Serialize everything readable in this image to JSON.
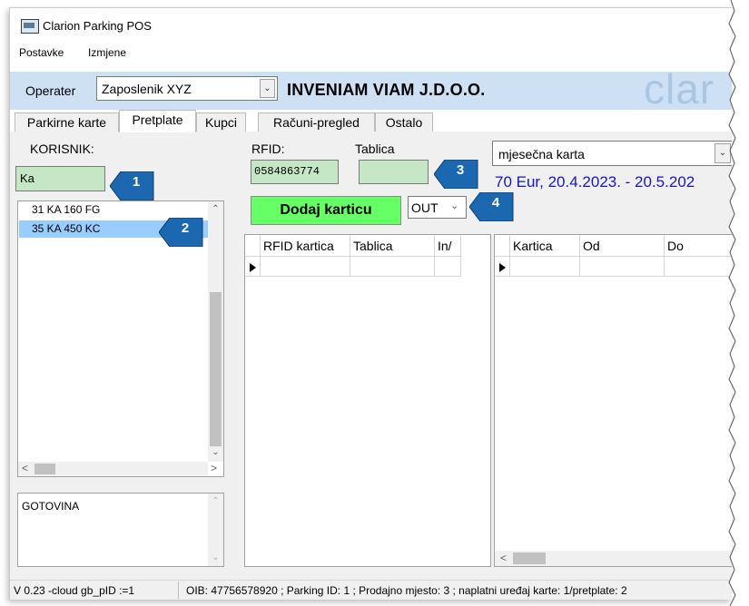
{
  "window": {
    "title": "Clarion Parking POS"
  },
  "menu": [
    "Postavke",
    "Izmjene"
  ],
  "operator": {
    "label": "Operater",
    "selected": "Zaposlenik XYZ",
    "company": "INVENIAM VIAM J.D.O.O.",
    "logo_text": "clar"
  },
  "tabs": [
    "Parkirne karte",
    "Pretplate",
    "Kupci",
    "Računi-pregled",
    "Ostalo"
  ],
  "active_tab": "Pretplate",
  "korisnik": {
    "label": "KORISNIK:",
    "search_value": "Ka",
    "items": [
      "31  KA 160 FG",
      "35  KA 450 KC"
    ],
    "selected_index": 1,
    "payment_text": "GOTOVINA"
  },
  "card": {
    "rfid_label": "RFID:",
    "rfid_value": "0584863774",
    "tablica_label": "Tablica",
    "tablica_value": "",
    "add_button": "Dodaj karticu",
    "direction": "OUT",
    "type_selected": "mjesečna karta",
    "price_info": "70 Eur,  20.4.2023. - 20.5.202"
  },
  "grid_cards": {
    "columns": [
      "RFID kartica",
      "Tablica",
      "In/"
    ]
  },
  "grid_subs": {
    "columns": [
      "Kartica",
      "Od",
      "Do"
    ]
  },
  "status": {
    "version": "V 0.23 -cloud gb_pID :=1",
    "info": "OIB: 47756578920 ; Parking ID: 1 ; Prodajno mjesto: 3 ; naplatni uređaj karte: 1/pretplate: 2"
  },
  "callouts": [
    "1",
    "2",
    "3",
    "4"
  ],
  "colors": {
    "accent_bar": "#cde0f4",
    "field_green": "#c6e7c6",
    "button_green": "#66ff66",
    "selection": "#99ccff",
    "callout": "#1b67b0",
    "price_text": "#1515c8"
  }
}
